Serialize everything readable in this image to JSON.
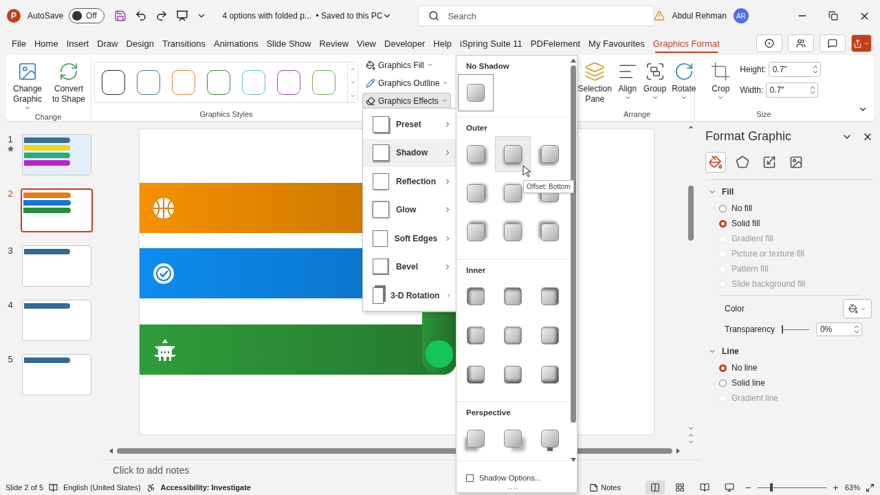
{
  "title_bar": {
    "logo": "P",
    "autosave": {
      "label": "AutoSave",
      "on": false,
      "state_text": "Off"
    },
    "document_title": "4 options with folded p...",
    "save_status": "• Saved to this PC",
    "search": {
      "placeholder": "Search"
    },
    "user_name": "Abdul Rehman",
    "avatar_initials": "AR"
  },
  "ribbon_tabs": [
    {
      "label": "File",
      "selected": false
    },
    {
      "label": "Home",
      "selected": false
    },
    {
      "label": "Insert",
      "selected": false
    },
    {
      "label": "Draw",
      "selected": false
    },
    {
      "label": "Design",
      "selected": false
    },
    {
      "label": "Transitions",
      "selected": false
    },
    {
      "label": "Animations",
      "selected": false
    },
    {
      "label": "Slide Show",
      "selected": false
    },
    {
      "label": "Review",
      "selected": false
    },
    {
      "label": "View",
      "selected": false
    },
    {
      "label": "Developer",
      "selected": false
    },
    {
      "label": "Help",
      "selected": false
    },
    {
      "label": "iSpring Suite 11",
      "selected": false
    },
    {
      "label": "PDFelement",
      "selected": false
    },
    {
      "label": "My Favourites",
      "selected": false
    },
    {
      "label": "Graphics Format",
      "selected": true
    }
  ],
  "ribbon": {
    "change_group": {
      "label": "Change",
      "buttons": [
        {
          "label": "Change Graphic",
          "dropdown": true
        },
        {
          "label": "Convert to Shape",
          "dropdown": false
        }
      ]
    },
    "styles_group": {
      "label": "Graphics Styles",
      "styles": [
        {
          "color": "#262626"
        },
        {
          "color": "#41719c"
        },
        {
          "color": "#ed7d31"
        },
        {
          "color": "#3f7f3f"
        },
        {
          "color": "#5bbad5"
        },
        {
          "color": "#a146b0"
        },
        {
          "color": "#70ad47"
        }
      ]
    },
    "graphics_commands": [
      {
        "label": "Graphics Fill",
        "expanded": false
      },
      {
        "label": "Graphics Outline",
        "expanded": false
      },
      {
        "label": "Graphics Effects",
        "expanded": true
      }
    ],
    "arrange_group": {
      "label": "Arrange",
      "buttons": [
        {
          "label": "Selection Pane",
          "dropdown": false
        },
        {
          "label": "Align",
          "dropdown": true
        },
        {
          "label": "Group",
          "dropdown": true
        },
        {
          "label": "Rotate",
          "dropdown": true
        }
      ]
    },
    "size_group": {
      "label": "Size",
      "crop": {
        "label": "Crop",
        "dropdown": true
      },
      "fields": [
        {
          "label": "Height:",
          "value": "0.7\""
        },
        {
          "label": "Width:",
          "value": "0.7\""
        }
      ]
    }
  },
  "effects_menu": [
    {
      "label": "Preset",
      "selected": false
    },
    {
      "label": "Shadow",
      "selected": true
    },
    {
      "label": "Reflection",
      "selected": false
    },
    {
      "label": "Glow",
      "selected": false
    },
    {
      "label": "Soft Edges",
      "selected": false
    },
    {
      "label": "Bevel",
      "selected": false
    },
    {
      "label": "3-D Rotation",
      "selected": false
    }
  ],
  "shadow_gallery": {
    "sections": [
      {
        "title": "No Shadow",
        "kind": "none",
        "items": [
          {
            "selected": true,
            "hovered": false
          }
        ]
      },
      {
        "title": "Outer",
        "kind": "outer",
        "items": [
          {
            "selected": false,
            "hovered": false
          },
          {
            "selected": false,
            "hovered": true
          },
          {
            "selected": false,
            "hovered": false
          },
          {
            "selected": false,
            "hovered": false
          },
          {
            "selected": false,
            "hovered": false
          },
          {
            "selected": false,
            "hovered": false
          },
          {
            "selected": false,
            "hovered": false
          },
          {
            "selected": false,
            "hovered": false
          },
          {
            "selected": false,
            "hovered": false
          }
        ]
      },
      {
        "title": "Inner",
        "kind": "inner",
        "items": [
          {
            "selected": false,
            "hovered": false
          },
          {
            "selected": false,
            "hovered": false
          },
          {
            "selected": false,
            "hovered": false
          },
          {
            "selected": false,
            "hovered": false
          },
          {
            "selected": false,
            "hovered": false
          },
          {
            "selected": false,
            "hovered": false
          },
          {
            "selected": false,
            "hovered": false
          },
          {
            "selected": false,
            "hovered": false
          },
          {
            "selected": false,
            "hovered": false
          }
        ]
      },
      {
        "title": "Perspective",
        "kind": "perspective",
        "items": [
          {
            "selected": false,
            "hovered": false
          },
          {
            "selected": false,
            "hovered": false
          },
          {
            "selected": false,
            "hovered": false
          }
        ]
      }
    ],
    "tooltip": "Offset: Bottom",
    "options": {
      "label": "Shadow Options...",
      "checked": false
    }
  },
  "slides": [
    {
      "number": "1",
      "animated": true,
      "selected": false,
      "bars": [
        {
          "color": "#3a6e9a"
        },
        {
          "color": "#f2d21c"
        },
        {
          "color": "#1fae8c"
        },
        {
          "color": "#c21fc9"
        }
      ]
    },
    {
      "number": "2",
      "animated": false,
      "selected": true,
      "bars": [
        {
          "color": "#ee7a10"
        },
        {
          "color": "#1673e0"
        },
        {
          "color": "#21913a"
        }
      ]
    },
    {
      "number": "3",
      "animated": false,
      "selected": false,
      "bars": [
        {
          "color": "#336a94"
        }
      ]
    },
    {
      "number": "4",
      "animated": false,
      "selected": false,
      "bars": [
        {
          "color": "#336a94"
        }
      ]
    },
    {
      "number": "5",
      "animated": false,
      "selected": false,
      "bars": [
        {
          "color": "#336a94"
        }
      ]
    }
  ],
  "slide": {
    "banners": [
      {
        "kind": "ball",
        "color": "#f59000"
      },
      {
        "kind": "badge",
        "color": "#0d8cf0"
      },
      {
        "kind": "pagoda",
        "color": "#2f9c3a"
      }
    ]
  },
  "notes": {
    "placeholder": "Click to add notes"
  },
  "format_pane": {
    "title": "Format Graphic",
    "tabs": [
      {
        "kind": "fill",
        "selected": true
      },
      {
        "kind": "effects",
        "selected": false
      },
      {
        "kind": "size",
        "selected": false
      },
      {
        "kind": "picture",
        "selected": false
      }
    ],
    "fill": {
      "label": "Fill",
      "expanded": true,
      "options": [
        {
          "label": "No fill",
          "selected": false,
          "disabled": false
        },
        {
          "label": "Solid fill",
          "selected": true,
          "disabled": false
        },
        {
          "label": "Gradient fill",
          "selected": false,
          "disabled": true
        },
        {
          "label": "Picture or texture fill",
          "selected": false,
          "disabled": true
        },
        {
          "label": "Pattern fill",
          "selected": false,
          "disabled": true
        },
        {
          "label": "Slide background fill",
          "selected": false,
          "disabled": true
        }
      ],
      "color_label": "Color",
      "transparency": {
        "label": "Transparency",
        "level": 0,
        "value": "0%"
      }
    },
    "line": {
      "label": "Line",
      "expanded": true,
      "options": [
        {
          "label": "No line",
          "selected": true,
          "disabled": false
        },
        {
          "label": "Solid line",
          "selected": false,
          "disabled": false
        },
        {
          "label": "Gradient line",
          "selected": false,
          "disabled": true
        }
      ]
    }
  },
  "status_bar": {
    "slide_position": "Slide 2 of 5",
    "language": "English (United States)",
    "accessibility": "Accessibility: Investigate",
    "notes_label": "Notes",
    "views": [
      {
        "kind": "normal",
        "selected": true
      },
      {
        "kind": "sorter",
        "selected": false
      },
      {
        "kind": "reading",
        "selected": false
      },
      {
        "kind": "show",
        "selected": false
      }
    ],
    "zoom": {
      "level": 0.18,
      "value": "63%"
    }
  }
}
